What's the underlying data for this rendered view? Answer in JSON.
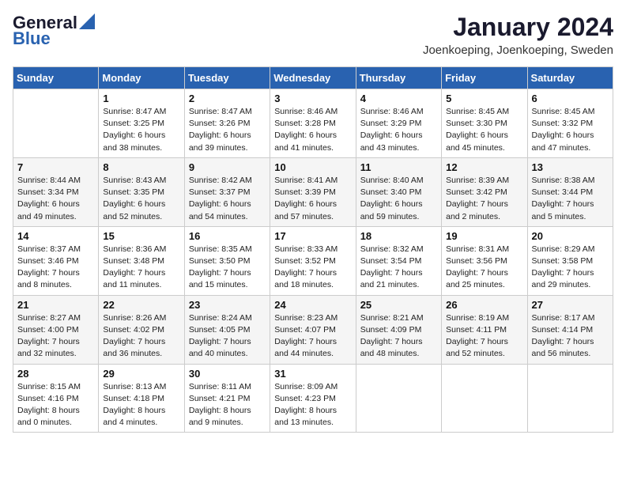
{
  "logo": {
    "general": "General",
    "blue": "Blue"
  },
  "title": "January 2024",
  "location": "Joenkoeping, Joenkoeping, Sweden",
  "days_of_week": [
    "Sunday",
    "Monday",
    "Tuesday",
    "Wednesday",
    "Thursday",
    "Friday",
    "Saturday"
  ],
  "weeks": [
    [
      {
        "day": "",
        "sunrise": "",
        "sunset": "",
        "daylight": ""
      },
      {
        "day": "1",
        "sunrise": "Sunrise: 8:47 AM",
        "sunset": "Sunset: 3:25 PM",
        "daylight": "Daylight: 6 hours and 38 minutes."
      },
      {
        "day": "2",
        "sunrise": "Sunrise: 8:47 AM",
        "sunset": "Sunset: 3:26 PM",
        "daylight": "Daylight: 6 hours and 39 minutes."
      },
      {
        "day": "3",
        "sunrise": "Sunrise: 8:46 AM",
        "sunset": "Sunset: 3:28 PM",
        "daylight": "Daylight: 6 hours and 41 minutes."
      },
      {
        "day": "4",
        "sunrise": "Sunrise: 8:46 AM",
        "sunset": "Sunset: 3:29 PM",
        "daylight": "Daylight: 6 hours and 43 minutes."
      },
      {
        "day": "5",
        "sunrise": "Sunrise: 8:45 AM",
        "sunset": "Sunset: 3:30 PM",
        "daylight": "Daylight: 6 hours and 45 minutes."
      },
      {
        "day": "6",
        "sunrise": "Sunrise: 8:45 AM",
        "sunset": "Sunset: 3:32 PM",
        "daylight": "Daylight: 6 hours and 47 minutes."
      }
    ],
    [
      {
        "day": "7",
        "sunrise": "Sunrise: 8:44 AM",
        "sunset": "Sunset: 3:34 PM",
        "daylight": "Daylight: 6 hours and 49 minutes."
      },
      {
        "day": "8",
        "sunrise": "Sunrise: 8:43 AM",
        "sunset": "Sunset: 3:35 PM",
        "daylight": "Daylight: 6 hours and 52 minutes."
      },
      {
        "day": "9",
        "sunrise": "Sunrise: 8:42 AM",
        "sunset": "Sunset: 3:37 PM",
        "daylight": "Daylight: 6 hours and 54 minutes."
      },
      {
        "day": "10",
        "sunrise": "Sunrise: 8:41 AM",
        "sunset": "Sunset: 3:39 PM",
        "daylight": "Daylight: 6 hours and 57 minutes."
      },
      {
        "day": "11",
        "sunrise": "Sunrise: 8:40 AM",
        "sunset": "Sunset: 3:40 PM",
        "daylight": "Daylight: 6 hours and 59 minutes."
      },
      {
        "day": "12",
        "sunrise": "Sunrise: 8:39 AM",
        "sunset": "Sunset: 3:42 PM",
        "daylight": "Daylight: 7 hours and 2 minutes."
      },
      {
        "day": "13",
        "sunrise": "Sunrise: 8:38 AM",
        "sunset": "Sunset: 3:44 PM",
        "daylight": "Daylight: 7 hours and 5 minutes."
      }
    ],
    [
      {
        "day": "14",
        "sunrise": "Sunrise: 8:37 AM",
        "sunset": "Sunset: 3:46 PM",
        "daylight": "Daylight: 7 hours and 8 minutes."
      },
      {
        "day": "15",
        "sunrise": "Sunrise: 8:36 AM",
        "sunset": "Sunset: 3:48 PM",
        "daylight": "Daylight: 7 hours and 11 minutes."
      },
      {
        "day": "16",
        "sunrise": "Sunrise: 8:35 AM",
        "sunset": "Sunset: 3:50 PM",
        "daylight": "Daylight: 7 hours and 15 minutes."
      },
      {
        "day": "17",
        "sunrise": "Sunrise: 8:33 AM",
        "sunset": "Sunset: 3:52 PM",
        "daylight": "Daylight: 7 hours and 18 minutes."
      },
      {
        "day": "18",
        "sunrise": "Sunrise: 8:32 AM",
        "sunset": "Sunset: 3:54 PM",
        "daylight": "Daylight: 7 hours and 21 minutes."
      },
      {
        "day": "19",
        "sunrise": "Sunrise: 8:31 AM",
        "sunset": "Sunset: 3:56 PM",
        "daylight": "Daylight: 7 hours and 25 minutes."
      },
      {
        "day": "20",
        "sunrise": "Sunrise: 8:29 AM",
        "sunset": "Sunset: 3:58 PM",
        "daylight": "Daylight: 7 hours and 29 minutes."
      }
    ],
    [
      {
        "day": "21",
        "sunrise": "Sunrise: 8:27 AM",
        "sunset": "Sunset: 4:00 PM",
        "daylight": "Daylight: 7 hours and 32 minutes."
      },
      {
        "day": "22",
        "sunrise": "Sunrise: 8:26 AM",
        "sunset": "Sunset: 4:02 PM",
        "daylight": "Daylight: 7 hours and 36 minutes."
      },
      {
        "day": "23",
        "sunrise": "Sunrise: 8:24 AM",
        "sunset": "Sunset: 4:05 PM",
        "daylight": "Daylight: 7 hours and 40 minutes."
      },
      {
        "day": "24",
        "sunrise": "Sunrise: 8:23 AM",
        "sunset": "Sunset: 4:07 PM",
        "daylight": "Daylight: 7 hours and 44 minutes."
      },
      {
        "day": "25",
        "sunrise": "Sunrise: 8:21 AM",
        "sunset": "Sunset: 4:09 PM",
        "daylight": "Daylight: 7 hours and 48 minutes."
      },
      {
        "day": "26",
        "sunrise": "Sunrise: 8:19 AM",
        "sunset": "Sunset: 4:11 PM",
        "daylight": "Daylight: 7 hours and 52 minutes."
      },
      {
        "day": "27",
        "sunrise": "Sunrise: 8:17 AM",
        "sunset": "Sunset: 4:14 PM",
        "daylight": "Daylight: 7 hours and 56 minutes."
      }
    ],
    [
      {
        "day": "28",
        "sunrise": "Sunrise: 8:15 AM",
        "sunset": "Sunset: 4:16 PM",
        "daylight": "Daylight: 8 hours and 0 minutes."
      },
      {
        "day": "29",
        "sunrise": "Sunrise: 8:13 AM",
        "sunset": "Sunset: 4:18 PM",
        "daylight": "Daylight: 8 hours and 4 minutes."
      },
      {
        "day": "30",
        "sunrise": "Sunrise: 8:11 AM",
        "sunset": "Sunset: 4:21 PM",
        "daylight": "Daylight: 8 hours and 9 minutes."
      },
      {
        "day": "31",
        "sunrise": "Sunrise: 8:09 AM",
        "sunset": "Sunset: 4:23 PM",
        "daylight": "Daylight: 8 hours and 13 minutes."
      },
      {
        "day": "",
        "sunrise": "",
        "sunset": "",
        "daylight": ""
      },
      {
        "day": "",
        "sunrise": "",
        "sunset": "",
        "daylight": ""
      },
      {
        "day": "",
        "sunrise": "",
        "sunset": "",
        "daylight": ""
      }
    ]
  ]
}
